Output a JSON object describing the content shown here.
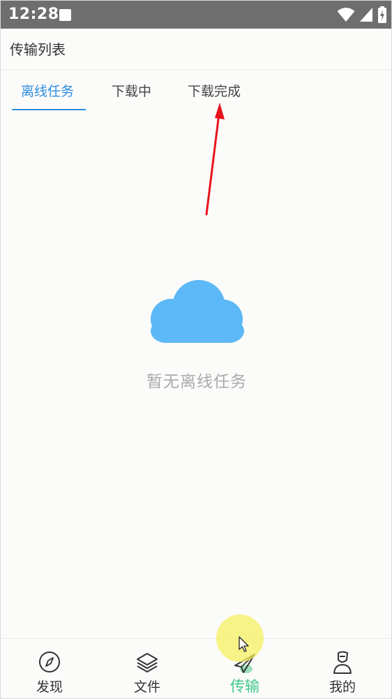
{
  "status_bar": {
    "time": "12:28",
    "icons": [
      "notification-square-icon",
      "wifi-icon",
      "signal-icon",
      "battery-charging-icon"
    ]
  },
  "header": {
    "title": "传输列表"
  },
  "tabs": [
    {
      "label": "离线任务",
      "active": true
    },
    {
      "label": "下载中",
      "active": false
    },
    {
      "label": "下载完成",
      "active": false
    }
  ],
  "empty_state": {
    "icon": "cloud-icon",
    "message": "暂无离线任务"
  },
  "bottom_nav": [
    {
      "label": "发现",
      "icon": "compass-icon",
      "active": false
    },
    {
      "label": "文件",
      "icon": "layers-icon",
      "active": false
    },
    {
      "label": "传输",
      "icon": "paper-plane-icon",
      "active": true
    },
    {
      "label": "我的",
      "icon": "user-icon",
      "active": false
    }
  ],
  "colors": {
    "accent_blue": "#2f8ee0",
    "active_green": "#3dc98a",
    "cloud_blue": "#5cb8f7",
    "annotation_red": "#e8141a",
    "status_bar": "#6e6e6e"
  }
}
